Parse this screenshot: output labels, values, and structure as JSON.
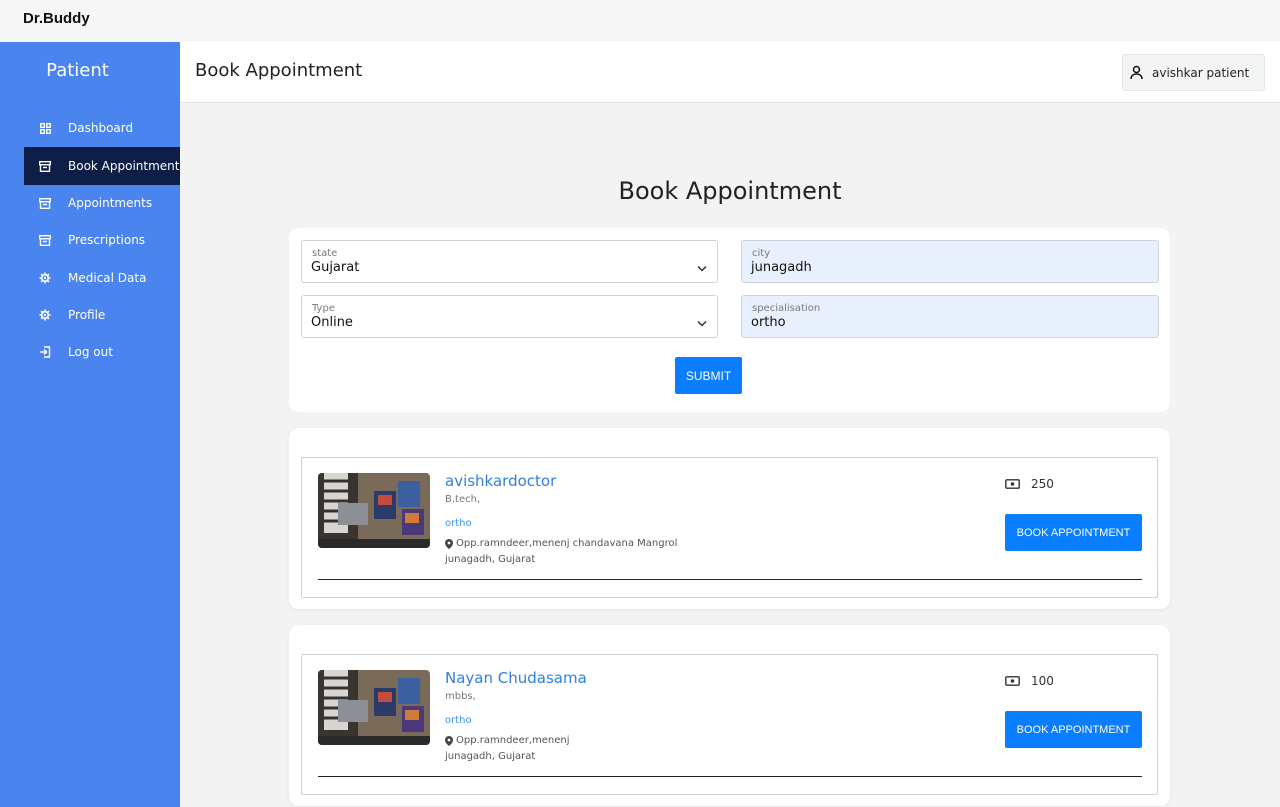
{
  "brand": "Dr.Buddy",
  "sidebar": {
    "title": "Patient",
    "items": [
      {
        "label": "Dashboard",
        "icon": "grid-icon"
      },
      {
        "label": "Book Appointment",
        "icon": "archive-icon"
      },
      {
        "label": "Appointments",
        "icon": "archive-icon"
      },
      {
        "label": "Prescriptions",
        "icon": "archive-icon"
      },
      {
        "label": "Medical Data",
        "icon": "gear-icon"
      },
      {
        "label": "Profile",
        "icon": "gear-icon"
      },
      {
        "label": "Log out",
        "icon": "logout-icon"
      }
    ],
    "active": "Book Appointment"
  },
  "header": {
    "title": "Book Appointment",
    "user": "avishkar patient"
  },
  "main": {
    "title": "Book Appointment",
    "form": {
      "state": {
        "label": "state",
        "value": "Gujarat"
      },
      "city": {
        "label": "city",
        "value": "junagadh"
      },
      "type": {
        "label": "Type",
        "value": "Online"
      },
      "specialisation": {
        "label": "specialisation",
        "value": "ortho"
      },
      "submit_label": "SUBMIT"
    },
    "doctors": [
      {
        "name": "avishkardoctor",
        "degree": "B.tech,",
        "specialisation": "ortho",
        "address": "Opp.ramndeer,menenj chandavana Mangrol",
        "location": "junagadh, Gujarat",
        "fee": "250",
        "book_label": "BOOK APPOINTMENT"
      },
      {
        "name": "Nayan Chudasama",
        "degree": "mbbs,",
        "specialisation": "ortho",
        "address": "Opp.ramndeer,menenj",
        "location": "junagadh, Gujarat",
        "fee": "100",
        "book_label": "BOOK APPOINTMENT"
      }
    ]
  },
  "colors": {
    "sidebar": "#4a84ee",
    "sidebar_active": "#0e1e46",
    "primary_button": "#0b7dff",
    "doctor_name": "#2f7fe0",
    "filled_field": "#e8f0fe"
  }
}
